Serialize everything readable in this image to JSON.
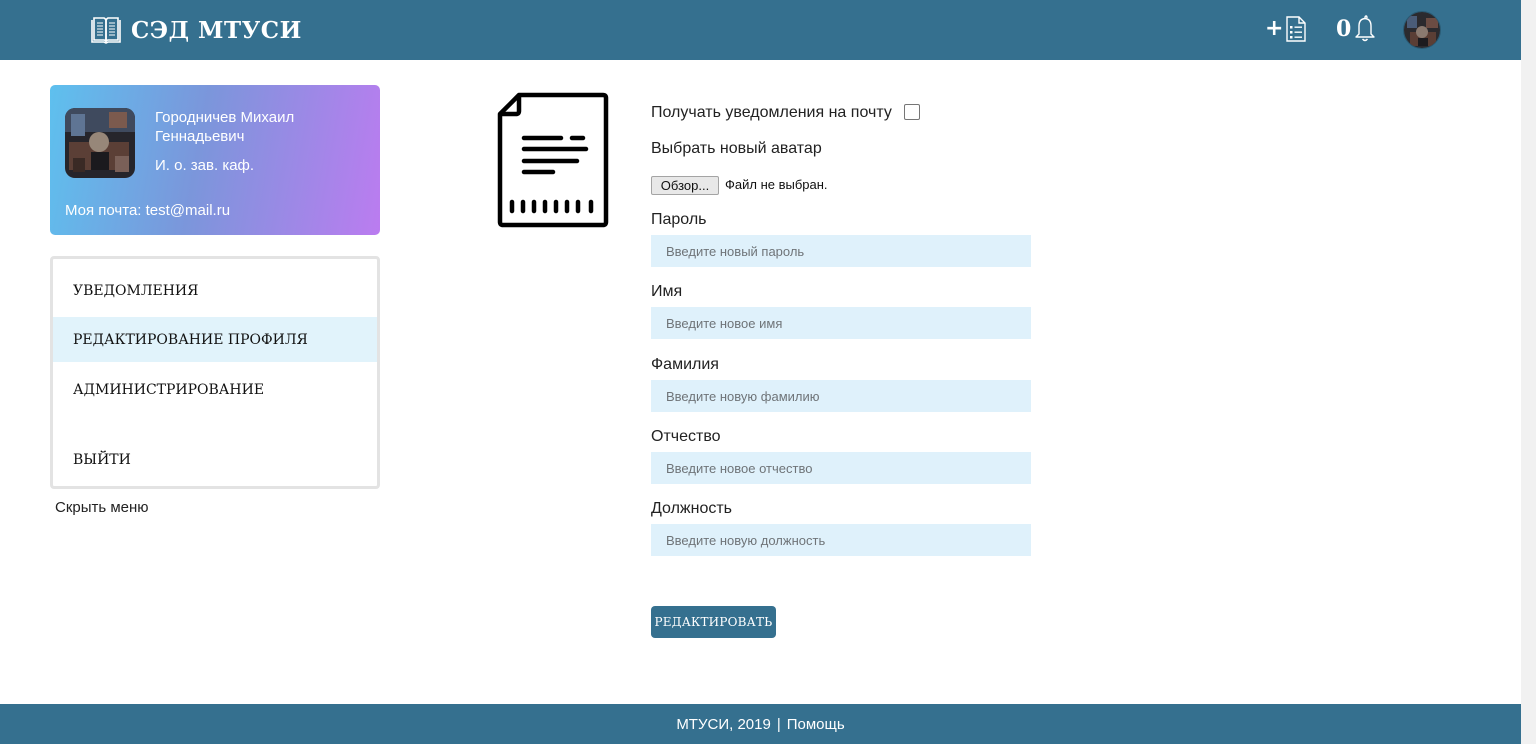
{
  "app": {
    "title": "СЭД МТУСИ"
  },
  "header": {
    "add_icon": "plus-document-icon",
    "notification_count": "0",
    "bell_icon": "bell-icon"
  },
  "profile": {
    "name": "Городничев Михаил Геннадьевич",
    "role": "И. о. зав. каф.",
    "email": "Моя почта: test@mail.ru"
  },
  "menu": {
    "items": [
      {
        "label": "Уведомления",
        "active": false
      },
      {
        "label": "Редактирование профиля",
        "active": true
      },
      {
        "label": "Администрирование",
        "active": false
      },
      {
        "label": "Выйти",
        "active": false
      }
    ],
    "hide_label": "Скрыть меню"
  },
  "form": {
    "notify_label": "Получать уведомления на почту",
    "notify_checked": false,
    "avatar_label": "Выбрать новый аватар",
    "browse_label": "Обзор...",
    "file_status": "Файл не выбран.",
    "password": {
      "label": "Пароль",
      "placeholder": "Введите новый пароль"
    },
    "first_name": {
      "label": "Имя",
      "placeholder": "Введите новое имя"
    },
    "last_name": {
      "label": "Фамилия",
      "placeholder": "Введите новую фамилию"
    },
    "patronymic": {
      "label": "Отчество",
      "placeholder": "Введите новое отчество"
    },
    "position": {
      "label": "Должность",
      "placeholder": "Введите новую должность"
    },
    "submit_label": "РЕДАКТИРОВАТЬ"
  },
  "footer": {
    "copyright": "МТУСИ, 2019",
    "separator": "|",
    "help": "Помощь"
  },
  "colors": {
    "primary": "#35708f",
    "input_bg": "#dff1fb",
    "menu_active_bg": "#e1f3fb",
    "card_gradient_start": "#5ec0ee",
    "card_gradient_end": "#bb7cf0"
  }
}
